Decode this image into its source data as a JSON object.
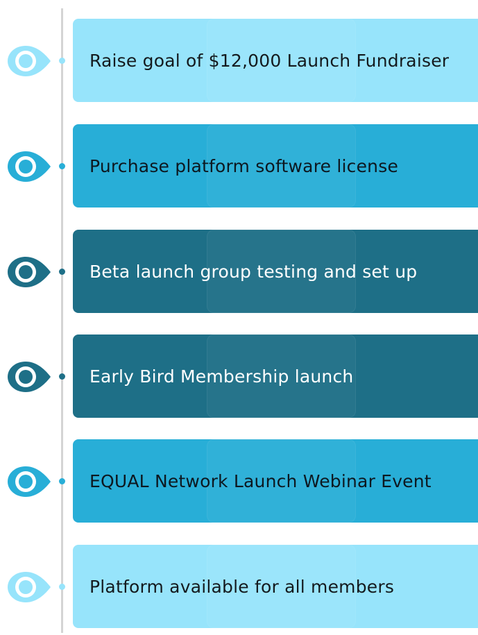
{
  "steps": [
    {
      "text": "Raise goal of $12,000 Launch Fundraiser",
      "card_color": "#97e4fb",
      "text_color": "#141a1e",
      "icon_color": "#97e4fb"
    },
    {
      "text": "Purchase platform software license",
      "card_color": "#28aed7",
      "text_color": "#0d1820",
      "icon_color": "#28aed7"
    },
    {
      "text": "Beta launch group testing and set up",
      "card_color": "#1e6f87",
      "text_color": "#ffffff",
      "icon_color": "#1e6f87"
    },
    {
      "text": "Early Bird Membership launch",
      "card_color": "#1e6f87",
      "text_color": "#ffffff",
      "icon_color": "#1e6f87"
    },
    {
      "text": "EQUAL Network Launch Webinar Event",
      "card_color": "#28aed7",
      "text_color": "#0d1820",
      "icon_color": "#28aed7"
    },
    {
      "text": "Platform available for all members",
      "card_color": "#97e4fb",
      "text_color": "#141a1e",
      "icon_color": "#97e4fb"
    }
  ]
}
